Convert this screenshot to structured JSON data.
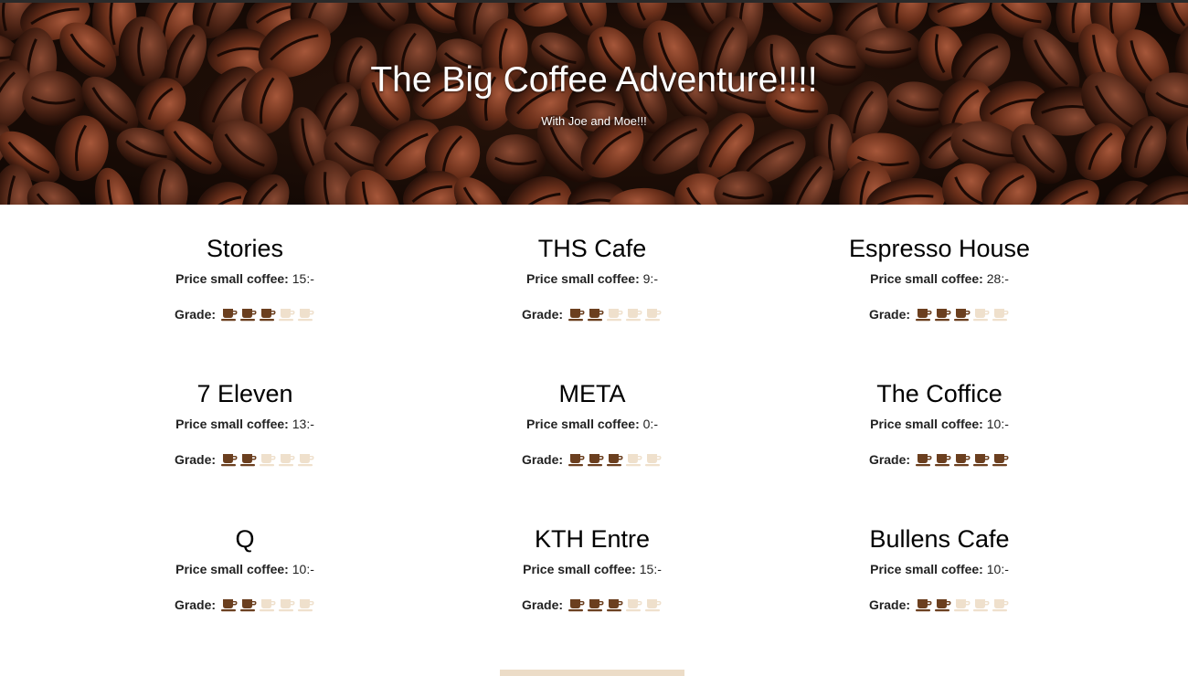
{
  "header": {
    "title": "The Big Coffee Adventure!!!!",
    "subtitle": "With Joe and Moe!!!"
  },
  "labels": {
    "price": "Price small coffee:",
    "grade": "Grade:"
  },
  "colors": {
    "cup_filled": "#6b3f1f",
    "cup_empty": "#efe0cc"
  },
  "max_grade": 5,
  "cafes": [
    {
      "name": "Stories",
      "price": "15:-",
      "grade": 3
    },
    {
      "name": "THS Cafe",
      "price": "9:-",
      "grade": 2
    },
    {
      "name": "Espresso House",
      "price": "28:-",
      "grade": 3
    },
    {
      "name": "7 Eleven",
      "price": "13:-",
      "grade": 2
    },
    {
      "name": "META",
      "price": "0:-",
      "grade": 3
    },
    {
      "name": "The Coffice",
      "price": "10:-",
      "grade": 5
    },
    {
      "name": "Q",
      "price": "10:-",
      "grade": 2
    },
    {
      "name": "KTH Entre",
      "price": "15:-",
      "grade": 3
    },
    {
      "name": "Bullens Cafe",
      "price": "10:-",
      "grade": 2
    }
  ]
}
